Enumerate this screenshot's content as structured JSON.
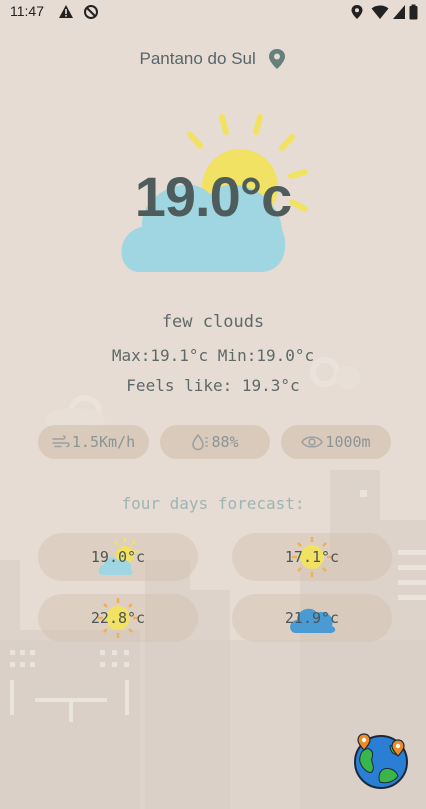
{
  "status": {
    "time": "11:47"
  },
  "location": {
    "name": "Pantano do Sul"
  },
  "current": {
    "temperature": "19.0°c",
    "description": "few clouds",
    "minmax": "Max:19.1°c Min:19.0°c",
    "feels_like": "Feels like: 19.3°c",
    "icon": "sun-behind-cloud-icon"
  },
  "stats": {
    "wind": "1.5Km/h",
    "humidity": "88%",
    "visibility": "1000m"
  },
  "forecast": {
    "title": "four days forecast:",
    "days": [
      {
        "temp": "19.0°c",
        "icon": "sun-cloud-icon"
      },
      {
        "temp": "17.1°c",
        "icon": "sun-icon"
      },
      {
        "temp": "22.8°c",
        "icon": "sun-icon"
      },
      {
        "temp": "21.9°c",
        "icon": "cloud-icon"
      }
    ]
  },
  "colors": {
    "background": "#e6dcd3",
    "text": "#5e6a6a",
    "sun": "#f2e263",
    "cloud": "#9fd6e2",
    "pill": "#d6c3b0"
  }
}
